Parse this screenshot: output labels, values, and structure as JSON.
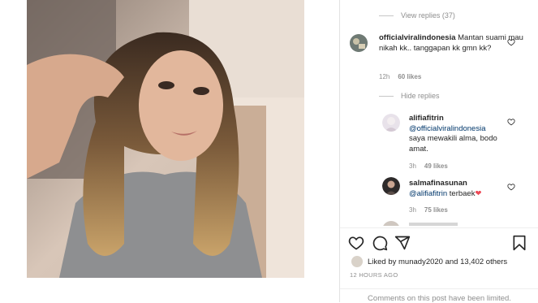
{
  "post": {
    "photo_alt": "",
    "comments": {
      "view_replies": "View replies (37)",
      "hide_replies": "Hide replies",
      "main_comment": {
        "username": "officialviralindonesia",
        "text": " Mantan suami mau nikah kk.. tanggapan kk gmn kk?",
        "time": "12h",
        "likes": "60 likes"
      },
      "reply1": {
        "username": "alifiafitrin",
        "mention": "@officialviralindonesia",
        "text": "saya mewakili alma, bodo amat.",
        "time": "3h",
        "likes": "49 likes"
      },
      "reply2": {
        "username": "salmafinasunan",
        "mention": "@alifiafitrin",
        "text": " terbaek",
        "emoji": "❤",
        "time": "3h",
        "likes": "75 likes"
      }
    },
    "liked_by": "Liked by munady2020 and 13,402 others",
    "time_ago": "12 HOURS AGO",
    "comments_limited": "Comments on this post have been limited."
  },
  "colors": {
    "text": "#262626",
    "muted": "#8e8e8e",
    "link": "#00376b",
    "heart_red": "#ed4956"
  },
  "icons": [
    "heart-icon",
    "comment-icon",
    "share-icon",
    "bookmark-icon"
  ]
}
